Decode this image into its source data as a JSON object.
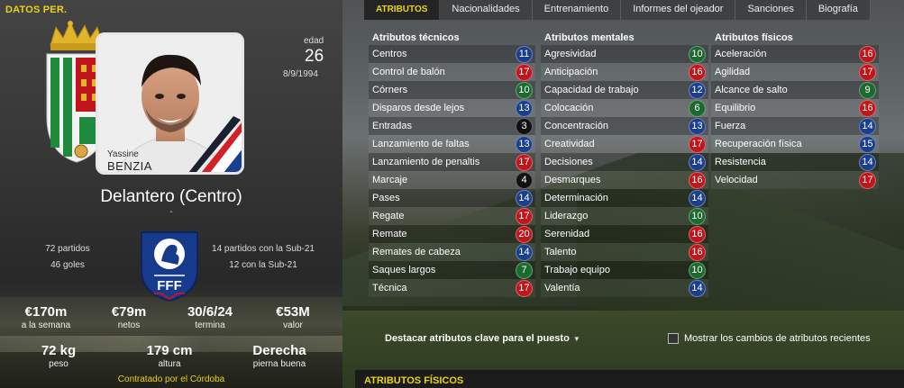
{
  "colors": {
    "accent": "#e8d21b",
    "badge_blue": "#1b3f8f",
    "badge_red": "#c0161b",
    "badge_green": "#1c6a2e",
    "badge_black": "#111111"
  },
  "left": {
    "panel_title": "DATOS PER.",
    "player": {
      "first_name": "Yassine",
      "last_name": "BENZIA"
    },
    "age_label": "edad",
    "age": "26",
    "dob": "8/9/1994",
    "position": "Delantero (Centro)",
    "dash": "-",
    "club_stats": {
      "matches": "72 partidos",
      "goals": "46 goles"
    },
    "intl_stats": {
      "u21_matches": "14 partidos con la Sub-21",
      "u21_goals": "12 con la Sub-21"
    },
    "finance": [
      {
        "value": "€170m",
        "label": "a la semana"
      },
      {
        "value": "€79m",
        "label": "netos"
      },
      {
        "value": "30/6/24",
        "label": "termina"
      },
      {
        "value": "€53M",
        "label": "valor"
      }
    ],
    "physical": [
      {
        "value": "72 kg",
        "label": "peso"
      },
      {
        "value": "179 cm",
        "label": "altura"
      },
      {
        "value": "Derecha",
        "label": "pierna buena"
      }
    ],
    "contract_text": "Contratado por el Córdoba",
    "fff_letters": "FFF"
  },
  "right": {
    "tabs": [
      "ATRIBUTOS",
      "Nacionalidades",
      "Entrenamiento",
      "Informes del ojeador",
      "Sanciones",
      "Biografía"
    ],
    "columns": [
      {
        "title": "Atributos técnicos",
        "rows": [
          {
            "label": "Centros",
            "value": 11,
            "color": "blue"
          },
          {
            "label": "Control de balón",
            "value": 17,
            "color": "red"
          },
          {
            "label": "Córners",
            "value": 10,
            "color": "green"
          },
          {
            "label": "Disparos desde lejos",
            "value": 13,
            "color": "blue"
          },
          {
            "label": "Entradas",
            "value": 3,
            "color": "black"
          },
          {
            "label": "Lanzamiento de faltas",
            "value": 13,
            "color": "blue"
          },
          {
            "label": "Lanzamiento de penaltis",
            "value": 17,
            "color": "red"
          },
          {
            "label": "Marcaje",
            "value": 4,
            "color": "black"
          },
          {
            "label": "Pases",
            "value": 14,
            "color": "blue"
          },
          {
            "label": "Regate",
            "value": 17,
            "color": "red"
          },
          {
            "label": "Remate",
            "value": 20,
            "color": "red"
          },
          {
            "label": "Remates de cabeza",
            "value": 14,
            "color": "blue"
          },
          {
            "label": "Saques largos",
            "value": 7,
            "color": "green"
          },
          {
            "label": "Técnica",
            "value": 17,
            "color": "red"
          }
        ]
      },
      {
        "title": "Atributos mentales",
        "rows": [
          {
            "label": "Agresividad",
            "value": 10,
            "color": "green"
          },
          {
            "label": "Anticipación",
            "value": 16,
            "color": "red"
          },
          {
            "label": "Capacidad de trabajo",
            "value": 12,
            "color": "blue"
          },
          {
            "label": "Colocación",
            "value": 6,
            "color": "green"
          },
          {
            "label": "Concentración",
            "value": 13,
            "color": "blue"
          },
          {
            "label": "Creatividad",
            "value": 17,
            "color": "red"
          },
          {
            "label": "Decisiones",
            "value": 14,
            "color": "blue"
          },
          {
            "label": "Desmarques",
            "value": 16,
            "color": "red"
          },
          {
            "label": "Determinación",
            "value": 14,
            "color": "blue"
          },
          {
            "label": "Liderazgo",
            "value": 10,
            "color": "green"
          },
          {
            "label": "Serenidad",
            "value": 16,
            "color": "red"
          },
          {
            "label": "Talento",
            "value": 16,
            "color": "red"
          },
          {
            "label": "Trabajo equipo",
            "value": 10,
            "color": "green"
          },
          {
            "label": "Valentía",
            "value": 14,
            "color": "blue"
          }
        ]
      },
      {
        "title": "Atributos físicos",
        "rows": [
          {
            "label": "Aceleración",
            "value": 16,
            "color": "red"
          },
          {
            "label": "Agilidad",
            "value": 17,
            "color": "red"
          },
          {
            "label": "Alcance de salto",
            "value": 9,
            "color": "green"
          },
          {
            "label": "Equilibrio",
            "value": 16,
            "color": "red"
          },
          {
            "label": "Fuerza",
            "value": 14,
            "color": "blue"
          },
          {
            "label": "Recuperación física",
            "value": 15,
            "color": "blue"
          },
          {
            "label": "Resistencia",
            "value": 14,
            "color": "blue"
          },
          {
            "label": "Velocidad",
            "value": 17,
            "color": "red"
          }
        ]
      }
    ],
    "highlight_label": "Destacar atributos clave para el puesto",
    "show_changes_label": "Mostrar los cambios de atributos recientes",
    "section_title": "ATRIBUTOS FÍSICOS"
  }
}
